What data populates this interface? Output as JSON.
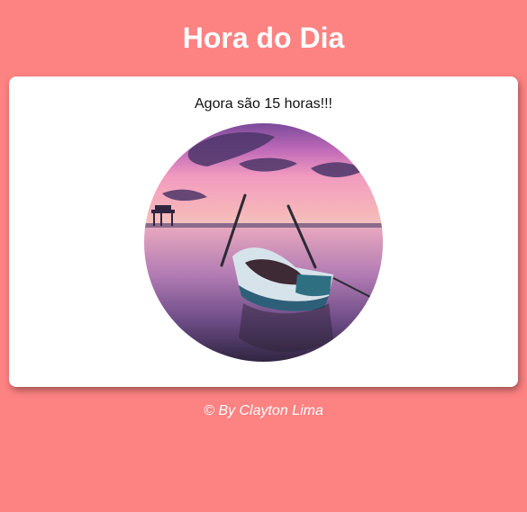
{
  "header": {
    "title": "Hora do Dia"
  },
  "card": {
    "message": "Agora são 15 horas!!!",
    "image_description": "Barco ao pôr do sol"
  },
  "footer": {
    "text": "© By Clayton Lima"
  },
  "colors": {
    "background": "#fd8282",
    "card": "#ffffff",
    "title": "#ffffff",
    "footer": "#ffffff"
  }
}
